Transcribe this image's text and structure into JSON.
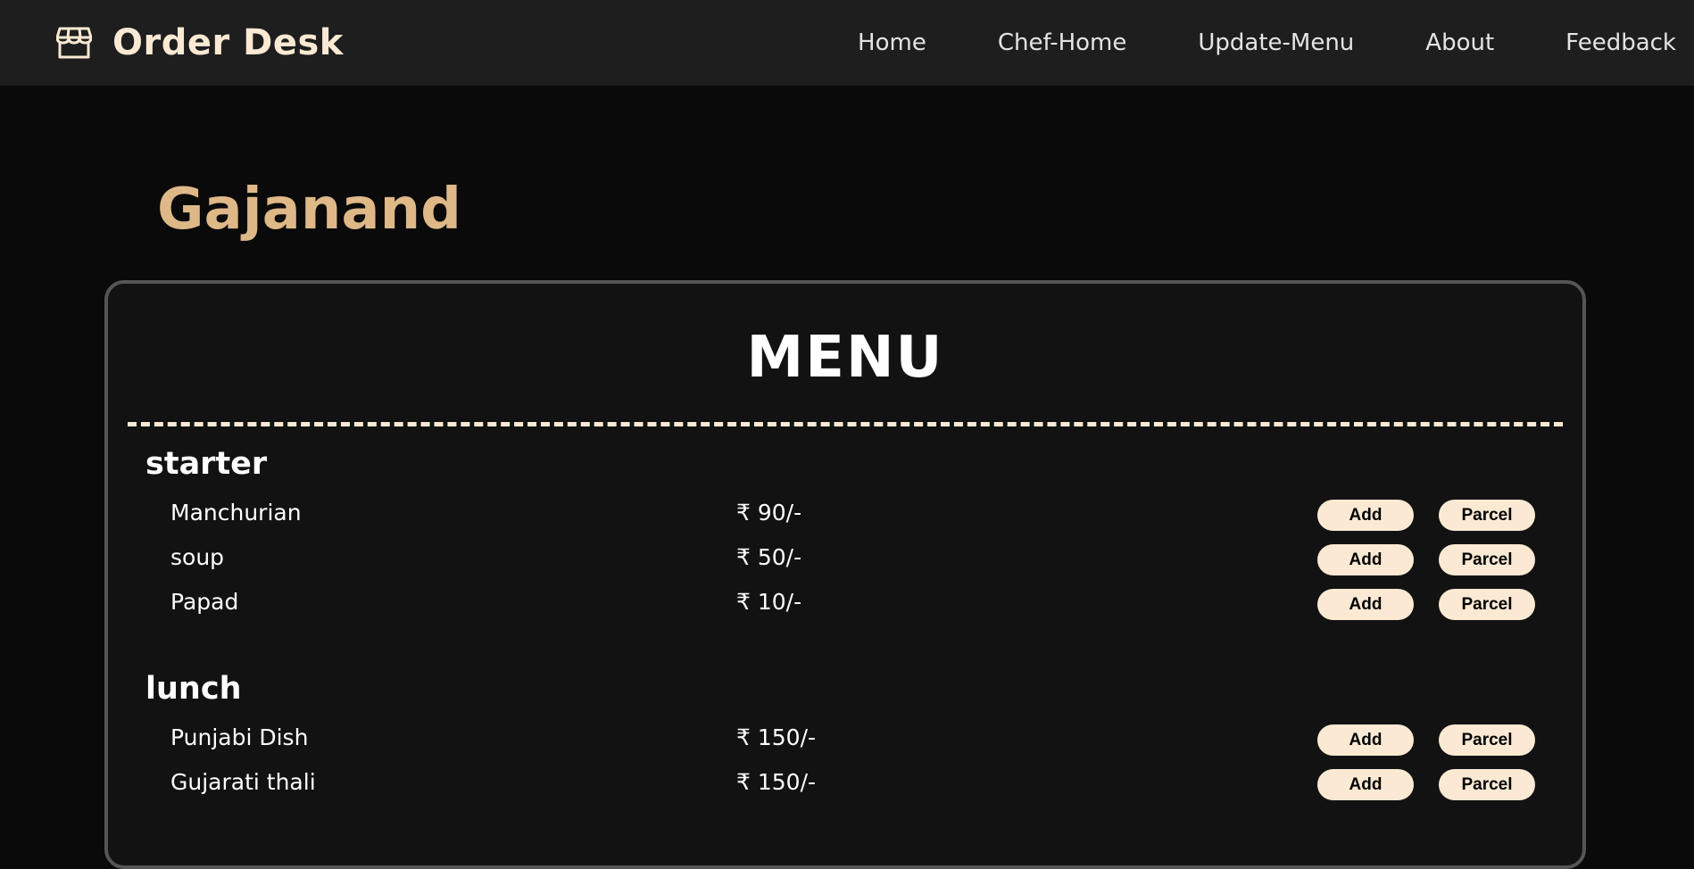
{
  "header": {
    "brand_title": "Order Desk",
    "brand_icon": "storefront-icon",
    "nav": [
      {
        "label": "Home"
      },
      {
        "label": "Chef-Home"
      },
      {
        "label": "Update-Menu"
      },
      {
        "label": "About"
      },
      {
        "label": "Feedback"
      }
    ]
  },
  "restaurant": {
    "name": "Gajanand"
  },
  "menu": {
    "title": "MENU",
    "add_label": "Add",
    "parcel_label": "Parcel",
    "categories": [
      {
        "name": "starter",
        "items": [
          {
            "name": "Manchurian",
            "price": "₹ 90/-"
          },
          {
            "name": "soup",
            "price": "₹ 50/-"
          },
          {
            "name": "Papad",
            "price": "₹ 10/-"
          }
        ]
      },
      {
        "name": "lunch",
        "items": [
          {
            "name": "Punjabi Dish",
            "price": "₹ 150/-"
          },
          {
            "name": "Gujarati thali",
            "price": "₹ 150/-"
          }
        ]
      }
    ]
  },
  "colors": {
    "navbar_bg": "#1e1e1e",
    "page_bg": "#0a0a0a",
    "accent_cream": "#fbe9d3",
    "restaurant_name": "#deb887",
    "card_border": "#555555"
  }
}
